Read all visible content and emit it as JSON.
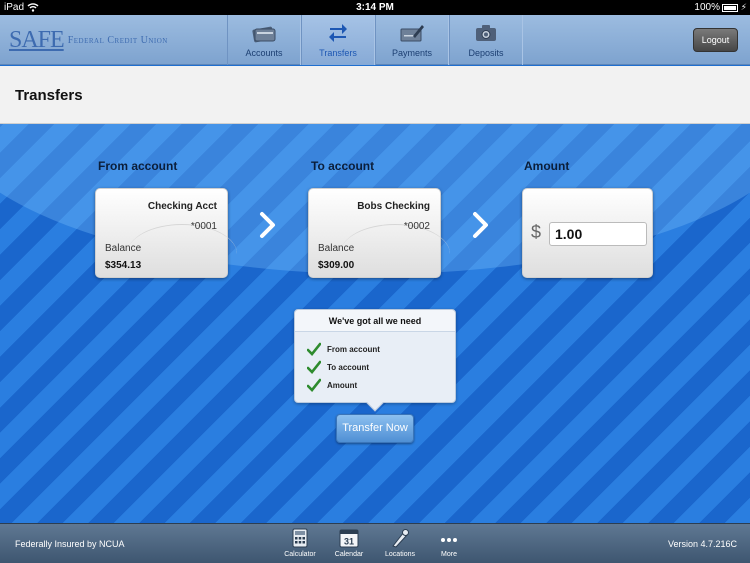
{
  "status_bar": {
    "device": "iPad",
    "time": "3:14 PM",
    "battery": "100%"
  },
  "logo": {
    "main": "SAFE",
    "sub": "Federal Credit Union"
  },
  "tabs": [
    {
      "label": "Accounts",
      "icon": "wallet-icon",
      "active": false
    },
    {
      "label": "Transfers",
      "icon": "transfer-arrows-icon",
      "active": true
    },
    {
      "label": "Payments",
      "icon": "checkbook-icon",
      "active": false
    },
    {
      "label": "Deposits",
      "icon": "camera-icon",
      "active": false
    }
  ],
  "logout_label": "Logout",
  "page_title": "Transfers",
  "from": {
    "label": "From account",
    "name": "Checking Acct",
    "number": "*0001",
    "balance_label": "Balance",
    "balance": "$354.13"
  },
  "to": {
    "label": "To account",
    "name": "Bobs Checking",
    "number": "*0002",
    "balance_label": "Balance",
    "balance": "$309.00"
  },
  "amount": {
    "label": "Amount",
    "currency": "$",
    "value": "1.00"
  },
  "checklist": {
    "title": "We've got all we need",
    "items": [
      "From account",
      "To account",
      "Amount"
    ]
  },
  "transfer_button": "Transfer Now",
  "footer": {
    "insured": "Federally Insured by NCUA",
    "version": "Version 4.7.216C",
    "tools": [
      {
        "label": "Calculator",
        "icon": "calculator-icon"
      },
      {
        "label": "Calendar",
        "icon": "calendar-icon",
        "day": "31"
      },
      {
        "label": "Locations",
        "icon": "map-pin-icon"
      },
      {
        "label": "More",
        "icon": "more-dots-icon"
      }
    ]
  },
  "colors": {
    "accent": "#1d57b3",
    "stripe_light": "#2a7ee0",
    "stripe_dark": "#1a66cc",
    "check_green": "#2e8b2e"
  }
}
